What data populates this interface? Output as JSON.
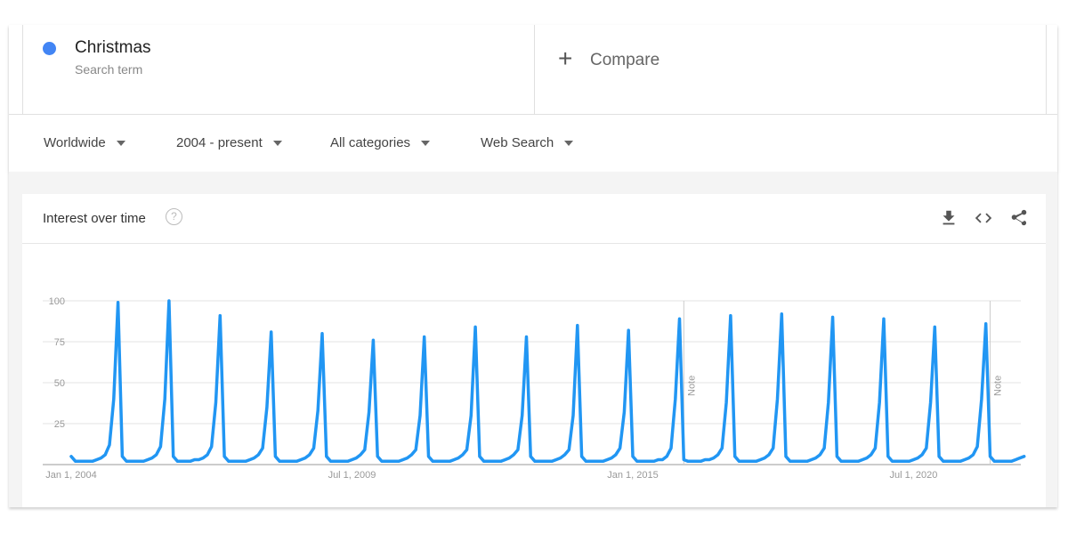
{
  "search_term": {
    "name": "Christmas",
    "subtitle": "Search term",
    "color": "#4285f4"
  },
  "compare": {
    "icon": "plus-icon",
    "label": "Compare"
  },
  "filters": [
    {
      "label": "Worldwide"
    },
    {
      "label": "2004 - present"
    },
    {
      "label": "All categories"
    },
    {
      "label": "Web Search"
    }
  ],
  "chart_card": {
    "title": "Interest over time",
    "help_icon": "question-circle-icon",
    "tools": [
      "download-icon",
      "embed-code-icon",
      "share-icon"
    ]
  },
  "chart_data": {
    "type": "line",
    "title": "",
    "xlabel": "",
    "ylabel": "",
    "ylim": [
      0,
      100
    ],
    "yticks": [
      25,
      50,
      75,
      100
    ],
    "xticks": [
      {
        "label": "Jan 1, 2004",
        "date": "2004-01"
      },
      {
        "label": "Jul 1, 2009",
        "date": "2009-07"
      },
      {
        "label": "Jan 1, 2015",
        "date": "2015-01"
      },
      {
        "label": "Jul 1, 2020",
        "date": "2020-07"
      }
    ],
    "grid": true,
    "line_color": "#2196f3",
    "start": "2004-01",
    "frequency": "monthly",
    "series": [
      {
        "values_by_year": {
          "2004": [
            5,
            2,
            2,
            2,
            2,
            2,
            3,
            4,
            6,
            12,
            40,
            99
          ],
          "2005": [
            5,
            2,
            2,
            2,
            2,
            2,
            3,
            4,
            6,
            11,
            40,
            100
          ],
          "2006": [
            5,
            2,
            2,
            2,
            2,
            3,
            3,
            4,
            6,
            11,
            38,
            91
          ],
          "2007": [
            5,
            2,
            2,
            2,
            2,
            2,
            3,
            4,
            6,
            10,
            35,
            81
          ],
          "2008": [
            5,
            2,
            2,
            2,
            2,
            2,
            3,
            4,
            6,
            10,
            33,
            80
          ],
          "2009": [
            5,
            2,
            2,
            2,
            2,
            2,
            3,
            4,
            6,
            9,
            32,
            76
          ],
          "2010": [
            5,
            2,
            2,
            2,
            2,
            2,
            3,
            4,
            6,
            9,
            30,
            78
          ],
          "2011": [
            5,
            2,
            2,
            2,
            2,
            2,
            3,
            4,
            6,
            9,
            30,
            84
          ],
          "2012": [
            5,
            2,
            2,
            2,
            2,
            2,
            3,
            4,
            6,
            9,
            30,
            78
          ],
          "2013": [
            5,
            2,
            2,
            2,
            2,
            2,
            3,
            4,
            6,
            9,
            30,
            85
          ],
          "2014": [
            5,
            2,
            2,
            2,
            2,
            2,
            3,
            4,
            6,
            10,
            32,
            82
          ],
          "2015": [
            5,
            2,
            2,
            2,
            2,
            2,
            3,
            3,
            5,
            10,
            40,
            89
          ],
          "2016": [
            3,
            2,
            2,
            2,
            2,
            3,
            3,
            4,
            6,
            10,
            38,
            91
          ],
          "2017": [
            5,
            2,
            2,
            2,
            2,
            2,
            3,
            4,
            6,
            10,
            40,
            92
          ],
          "2018": [
            5,
            2,
            2,
            2,
            2,
            2,
            3,
            4,
            6,
            10,
            38,
            90
          ],
          "2019": [
            5,
            2,
            2,
            2,
            2,
            2,
            3,
            4,
            6,
            10,
            38,
            89
          ],
          "2020": [
            5,
            2,
            2,
            2,
            2,
            2,
            3,
            4,
            6,
            10,
            38,
            84
          ],
          "2021": [
            5,
            2,
            2,
            2,
            2,
            2,
            3,
            4,
            6,
            11,
            40,
            86
          ],
          "2022": [
            5,
            2,
            2,
            2,
            2,
            2,
            3,
            4,
            5
          ]
        }
      }
    ],
    "annotations": [
      {
        "label": "Note",
        "date": "2016-01"
      },
      {
        "label": "Note",
        "date": "2022-01"
      }
    ]
  }
}
